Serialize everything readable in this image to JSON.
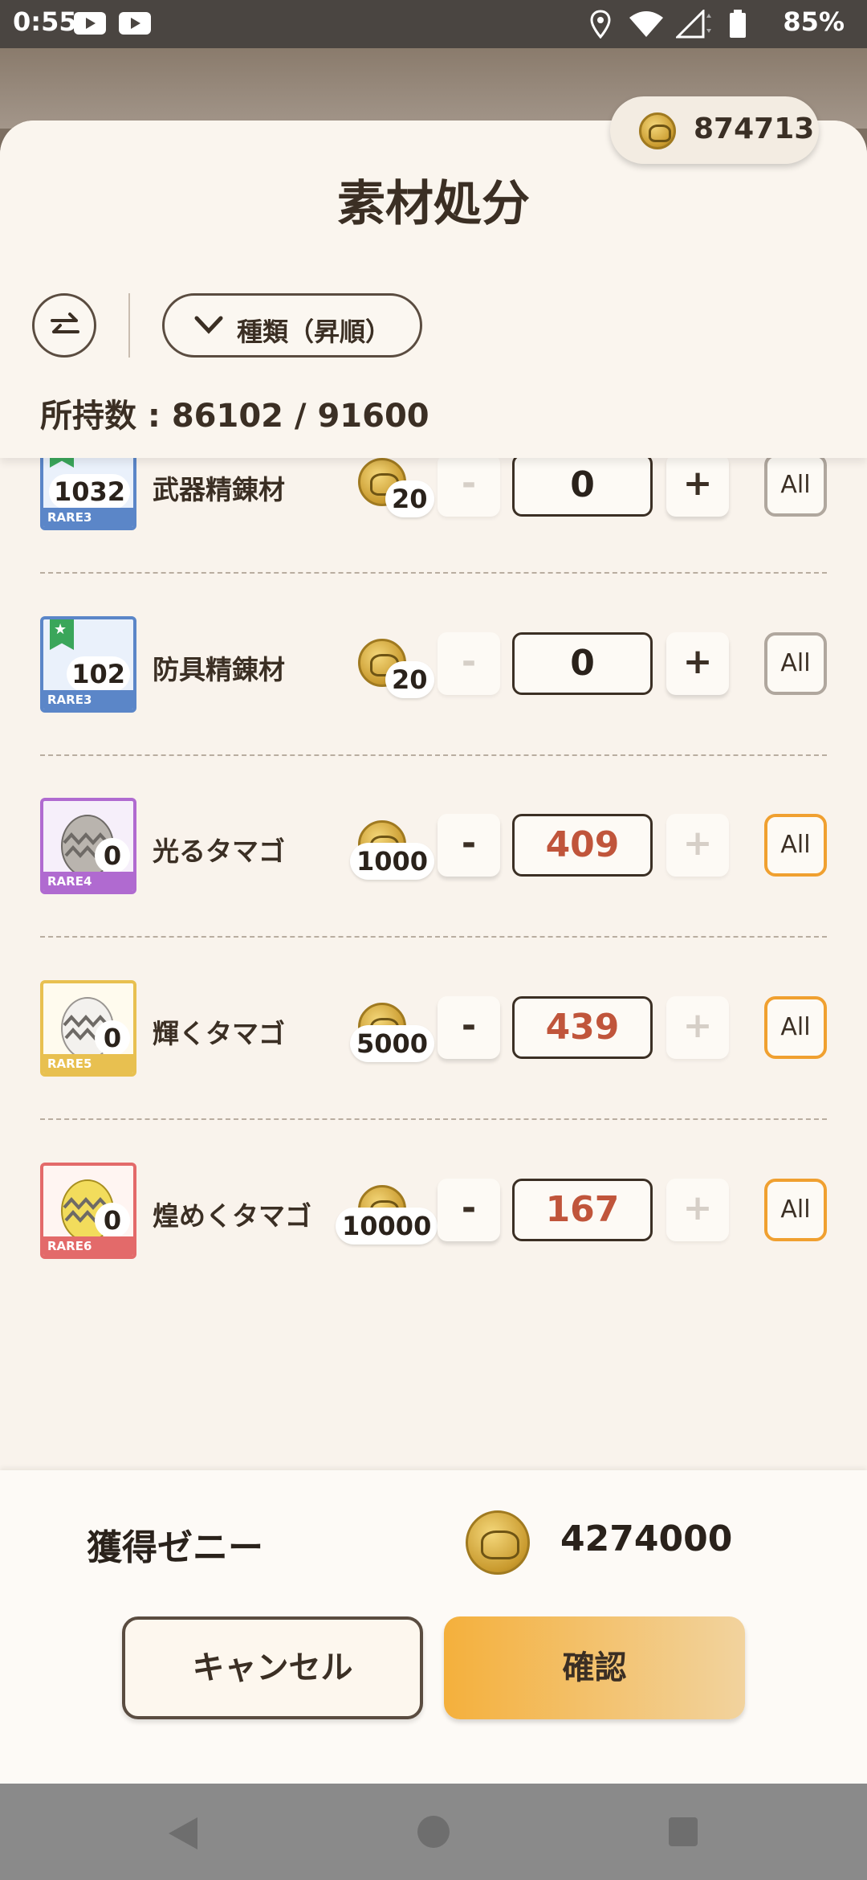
{
  "status_bar": {
    "time": "0:55",
    "battery": "85%"
  },
  "header": {
    "zeny": "874713",
    "title": "素材処分",
    "sort_label": "種類（昇順）",
    "owned_count": "所持数 : 86102 / 91600"
  },
  "items": [
    {
      "name": "武器精錬材",
      "rarity": "RARE3",
      "count": "1032",
      "price": "20",
      "quantity": "0",
      "minus": "-",
      "plus": "+",
      "all": "All"
    },
    {
      "name": "防具精錬材",
      "rarity": "RARE3",
      "count": "102",
      "price": "20",
      "quantity": "0",
      "minus": "-",
      "plus": "+",
      "all": "All"
    },
    {
      "name": "光るタマゴ",
      "rarity": "RARE4",
      "count": "0",
      "price": "1000",
      "quantity": "409",
      "minus": "-",
      "plus": "+",
      "all": "All"
    },
    {
      "name": "輝くタマゴ",
      "rarity": "RARE5",
      "count": "0",
      "price": "5000",
      "quantity": "439",
      "minus": "-",
      "plus": "+",
      "all": "All"
    },
    {
      "name": "煌めくタマゴ",
      "rarity": "RARE6",
      "count": "0",
      "price": "10000",
      "quantity": "167",
      "minus": "-",
      "plus": "+",
      "all": "All"
    }
  ],
  "colors": {
    "rare3": "#5b86c8",
    "rare4": "#b06ad0",
    "rare5": "#e8c050",
    "rare6": "#e36a6a",
    "accent_orange": "#f0a030",
    "quantity_red": "#c0553b"
  },
  "footer": {
    "earn_label": "獲得ゼニー",
    "earn_value": "4274000",
    "cancel_label": "キャンセル",
    "confirm_label": "確認"
  }
}
